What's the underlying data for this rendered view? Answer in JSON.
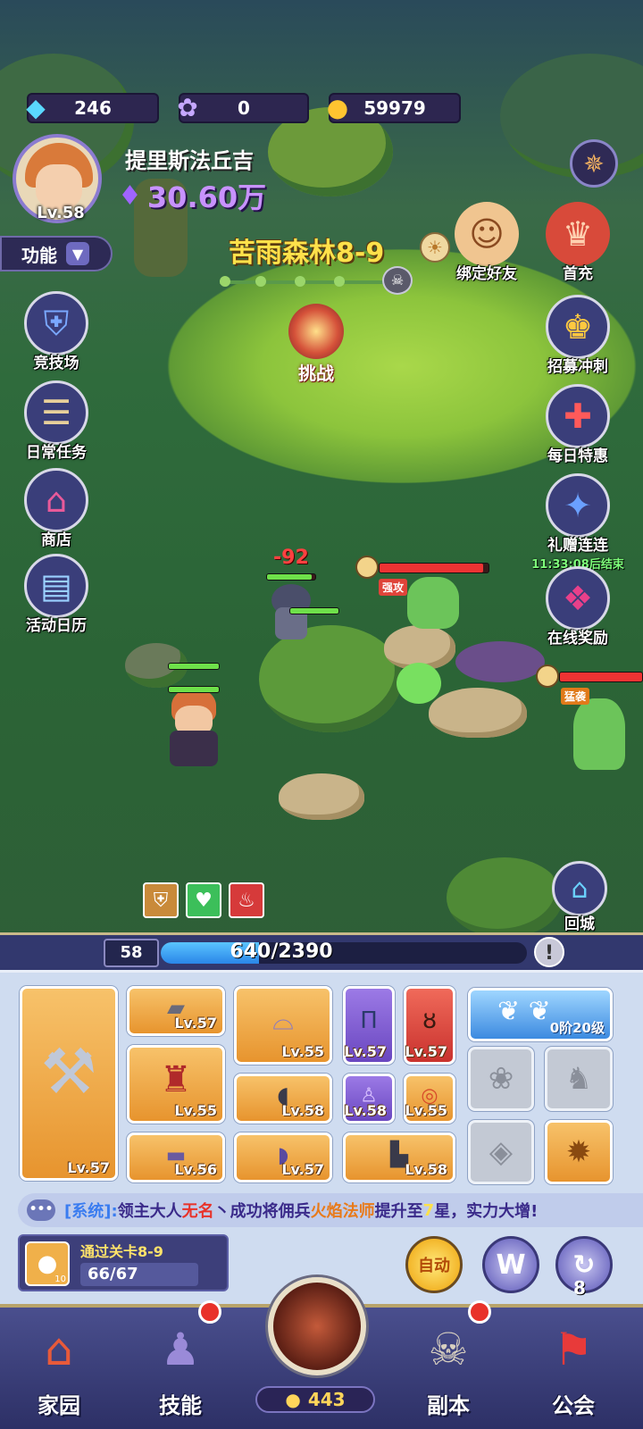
{
  "currency": {
    "diamonds": "246",
    "gems": "0",
    "gold": "59979"
  },
  "player": {
    "name": "提里斯法丘吉",
    "level": "Lv.58",
    "power": "30.60万"
  },
  "function_menu": {
    "label": "功能"
  },
  "left_menu": [
    {
      "label": "竞技场",
      "icon": "shield-icon"
    },
    {
      "label": "日常任务",
      "icon": "scroll-icon"
    },
    {
      "label": "商店",
      "icon": "shop-icon"
    },
    {
      "label": "活动日历",
      "icon": "calendar-icon"
    }
  ],
  "right_menu": [
    {
      "label": "绑定好友",
      "icon": "friends-icon"
    },
    {
      "label": "首充",
      "icon": "first-charge-icon"
    },
    {
      "label": "招募冲刺",
      "icon": "trophy-icon"
    },
    {
      "label": "每日特惠",
      "icon": "gift-icon"
    },
    {
      "label": "礼赠连连",
      "icon": "gift-bag-icon",
      "timer": "11:33:08后结束"
    },
    {
      "label": "在线奖励",
      "icon": "gift-box-icon"
    },
    {
      "label": "回城",
      "icon": "return-city-icon"
    }
  ],
  "stage": {
    "name": "苦雨森林8-9",
    "challenge_label": "挑战"
  },
  "battle": {
    "damage_text": "-92",
    "enemy_tags": [
      "强攻",
      "猛袭"
    ],
    "hero_hp_ratio": 0.92,
    "enemy_hp_ratio": 0.95
  },
  "experience": {
    "level": "58",
    "text": "640/2390",
    "ratio": 0.268
  },
  "equipment": {
    "weapon_level": "Lv.57",
    "items": [
      {
        "level": "Lv.57",
        "rarity": "orange"
      },
      {
        "level": "Lv.55",
        "rarity": "orange"
      },
      {
        "level": "Lv.57",
        "rarity": "purple"
      },
      {
        "level": "Lv.57",
        "rarity": "red"
      },
      {
        "level": "Lv.55",
        "rarity": "orange"
      },
      {
        "level": "Lv.58",
        "rarity": "orange"
      },
      {
        "level": "Lv.58",
        "rarity": "purple"
      },
      {
        "level": "Lv.55",
        "rarity": "orange"
      },
      {
        "level": "Lv.56",
        "rarity": "orange"
      },
      {
        "level": "Lv.57",
        "rarity": "orange"
      },
      {
        "level": "Lv.58",
        "rarity": "orange"
      }
    ],
    "wings_level": "0阶20级"
  },
  "system_message": {
    "prefix": "[系统]:",
    "text1": "领主大人",
    "name1": "无名",
    "text2": "丶成功将佣兵",
    "name2": "火焰法师",
    "text3": "提升至",
    "star": "7",
    "text4": "星，实力大增!"
  },
  "quest": {
    "title": "通过关卡8-9",
    "progress": "66/67",
    "item_count": "10"
  },
  "actions": {
    "auto_label": "自动",
    "w_label": "W",
    "ring_count": "8"
  },
  "nav": {
    "home": "家园",
    "skills": "技能",
    "dungeon": "副本",
    "guild": "公会",
    "bread_count": "443"
  },
  "colors": {
    "accent_purple": "#c892ff",
    "stage_yellow": "#ffe14a",
    "exp_blue": "#2a86e8",
    "system_blue": "#3a7cf0",
    "highlight_red": "#e8322a",
    "highlight_orange": "#e87a1a"
  }
}
